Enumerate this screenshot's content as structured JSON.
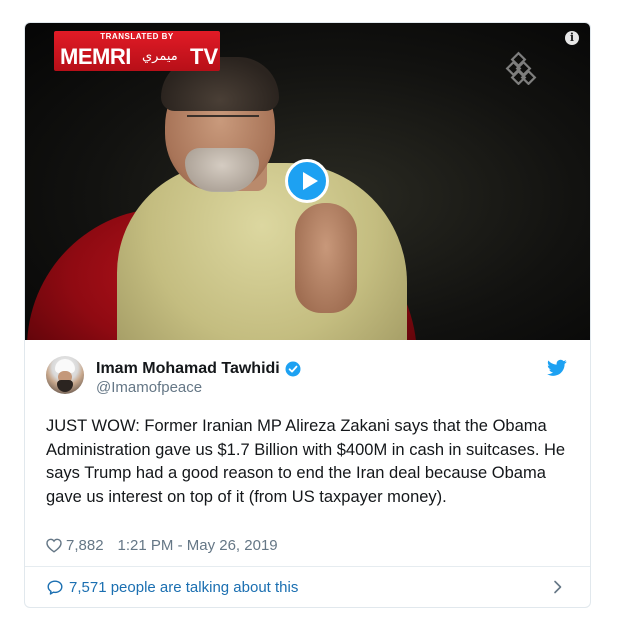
{
  "media": {
    "badge_top": "TRANSLATED BY",
    "badge_main": "MEMRI",
    "badge_arabic": "ميمري",
    "badge_tv": "TV",
    "info_label": "i"
  },
  "tweet": {
    "author_name": "Imam Mohamad Tawhidi",
    "handle": "@Imamofpeace",
    "text": "JUST WOW: Former Iranian MP Alireza Zakani says that the Obama Administration gave us $1.7 Billion with $400M in cash in suitcases. He says Trump had a good reason to end the Iran deal because Obama gave us interest on top of it (from US taxpayer money).",
    "likes": "7,882",
    "timestamp": "1:21 PM - May 26, 2019"
  },
  "footer": {
    "talking_text": "7,571 people are talking about this"
  },
  "colors": {
    "accent": "#1da1f2",
    "link": "#1b6fb1",
    "muted": "#657786",
    "text": "#14171a",
    "badge_red": "#d3131d"
  },
  "icons": {
    "play": "play-icon",
    "info": "info-icon",
    "verified": "verified-badge-icon",
    "bird": "twitter-bird-icon",
    "heart": "heart-icon",
    "bubble": "speech-bubble-icon",
    "chevron": "chevron-right-icon",
    "watermark": "channel-logo-icon"
  }
}
